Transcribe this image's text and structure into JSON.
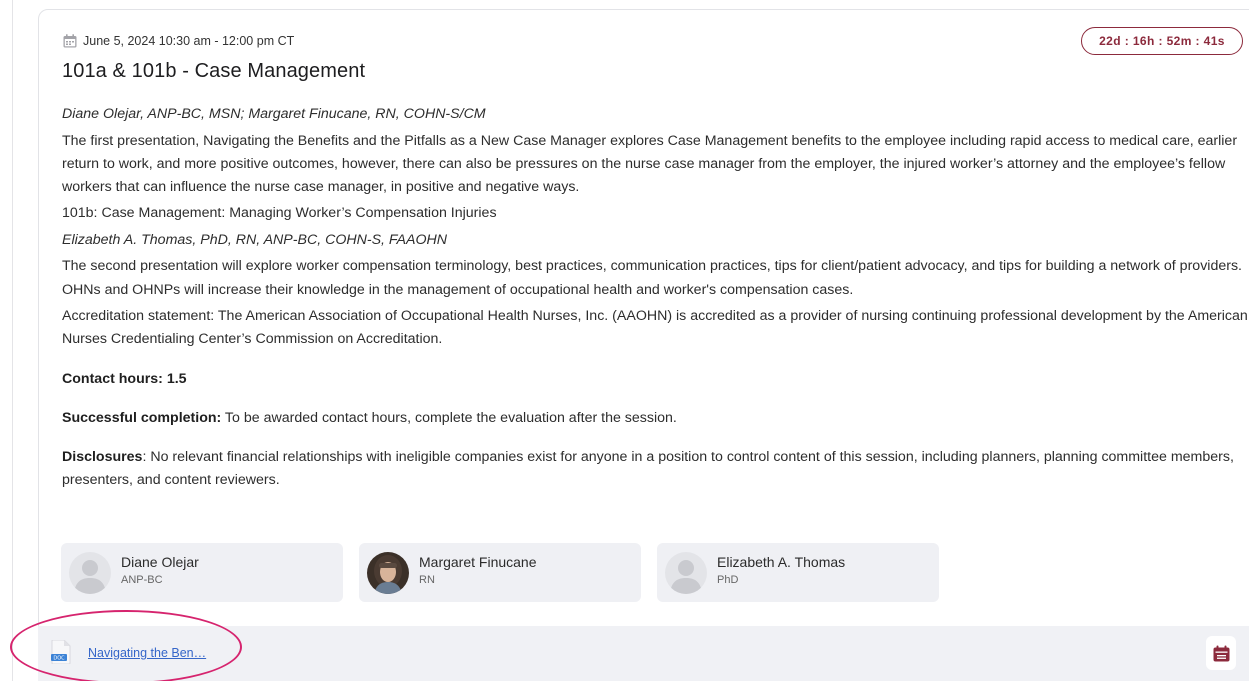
{
  "session": {
    "date_time": "June 5, 2024 10:30 am - 12:00 pm CT",
    "countdown": "22d : 16h : 52m : 41s",
    "title": "101a & 101b - Case Management",
    "authors_a": "Diane Olejar, ANP-BC, MSN; Margaret Finucane, RN, COHN-S/CM",
    "description_a": "The first presentation, Navigating the Benefits and the Pitfalls as a New Case Manager explores Case Management benefits to the employee including rapid access to medical care, earlier return to work, and more positive outcomes, however, there can also be pressures on the nurse case manager from the employer, the injured worker’s attorney and the employee’s fellow workers that can influence the nurse case manager, in positive and negative ways.",
    "subtitle_b": "101b: Case Management: Managing Worker’s Compensation Injuries",
    "authors_b": "Elizabeth A. Thomas, PhD, RN, ANP-BC, COHN-S, FAAOHN",
    "description_b": "The second presentation will explore worker compensation terminology, best practices, communication practices, tips for client/patient advocacy, and tips for building a network of providers. OHNs and OHNPs will increase their knowledge in the management of occupational health and worker's compensation cases.",
    "accreditation": "Accreditation statement:  The American Association of Occupational Health Nurses, Inc. (AAOHN) is accredited as a provider of nursing continuing professional development by the American Nurses Credentialing Center’s Commission on Accreditation.",
    "contact_hours": "Contact hours: 1.5",
    "completion_label": "Successful completion:",
    "completion_text": " To be awarded contact hours, complete the evaluation after the session.",
    "disclosures_label": "Disclosures",
    "disclosures_text": ": No relevant financial relationships with ineligible companies exist for anyone in a position to control content of this session, including planners, planning committee members, presenters, and content reviewers."
  },
  "speakers": [
    {
      "name": "Diane Olejar",
      "credential": "ANP-BC",
      "avatar": "placeholder-avatar-icon"
    },
    {
      "name": "Margaret Finucane",
      "credential": "RN",
      "avatar": "photo"
    },
    {
      "name": "Elizabeth A. Thomas",
      "credential": "PhD",
      "avatar": "placeholder-avatar-icon"
    }
  ],
  "attachments": {
    "file_link": "Navigating the Ben…",
    "file_type": "DOC"
  },
  "colors": {
    "accent": "#8c2a3c",
    "link": "#3566c9",
    "highlight": "#d6246e",
    "footer_bg": "#f0f1f5",
    "speaker_bg": "#eff0f4"
  }
}
